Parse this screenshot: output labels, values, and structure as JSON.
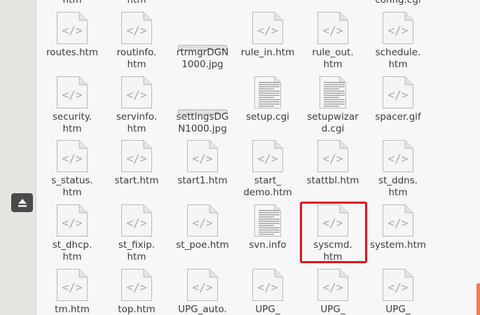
{
  "rows": [
    [
      "routes.htm",
      "routinfo.\nhtm",
      "rtrmgrDGN\n1000.jpg",
      "rule_in.htm",
      "rule_out.\nhtm",
      "schedule.\nhtm"
    ],
    [
      "security.\nhtm",
      "servinfo.\nhtm",
      "settingsDG\nN1000.jpg",
      "setup.cgi",
      "setupwizar\nd.cgi",
      "spacer.gif"
    ],
    [
      "s_status.\nhtm",
      "start.htm",
      "start1.htm",
      "start_\ndemo.htm",
      "stattbl.htm",
      "st_ddns.\nhtm"
    ],
    [
      "st_dhcp.\nhtm",
      "st_fixip.\nhtm",
      "st_poe.htm",
      "svn.info",
      "syscmd.\nhtm",
      "system.htm"
    ],
    [
      "tm.htm",
      "top.htm",
      "UPG_auto.",
      "UPG_",
      "UPG_",
      "UPG_"
    ]
  ],
  "partial_top": [
    "htm",
    "htm",
    "config.cgi"
  ],
  "types": [
    [
      "code",
      "code",
      "image",
      "code",
      "code",
      "code"
    ],
    [
      "code",
      "code",
      "image",
      "text",
      "text",
      "code"
    ],
    [
      "code",
      "code",
      "code",
      "code",
      "code",
      "code"
    ],
    [
      "code",
      "code",
      "code",
      "text",
      "code",
      "code"
    ],
    [
      "code",
      "code",
      "code",
      "code",
      "code",
      "code"
    ]
  ],
  "colors": {
    "highlight": "#e0131a",
    "sidebar": "#e6e4df",
    "accent": "#ef7b53"
  }
}
